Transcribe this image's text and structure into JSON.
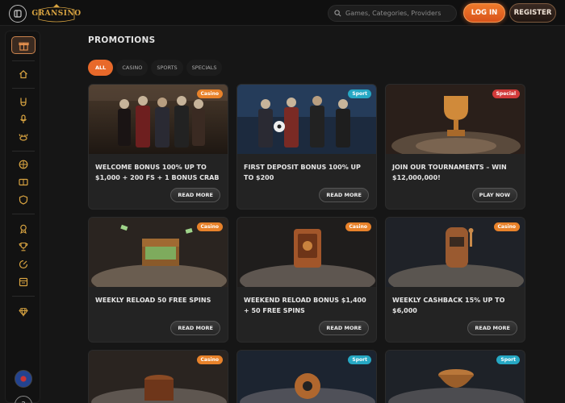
{
  "header": {
    "logo_text": "GRANSINO",
    "search_placeholder": "Games, Categories, Providers",
    "login_label": "LOG IN",
    "register_label": "REGISTER"
  },
  "page": {
    "title": "PROMOTIONS",
    "tabs": [
      {
        "label": "ALL",
        "active": true
      },
      {
        "label": "CASINO",
        "active": false
      },
      {
        "label": "SPORTS",
        "active": false
      },
      {
        "label": "SPECIALS",
        "active": false
      }
    ]
  },
  "cards": [
    {
      "badge": "Casino",
      "type": "casino",
      "text": "WELCOME BONUS 100% UP TO $1,000 + 200 FS + 1 BONUS CRAB",
      "cta": "READ MORE"
    },
    {
      "badge": "Sport",
      "type": "sport",
      "text": "FIRST DEPOSIT BONUS 100% UP TO $200",
      "cta": "READ MORE"
    },
    {
      "badge": "Special",
      "type": "special",
      "text": "JOIN OUR TOURNAMENTS – WIN $12,000,000!",
      "cta": "PLAY NOW"
    },
    {
      "badge": "Casino",
      "type": "casino",
      "text": "WEEKLY RELOAD 50 FREE SPINS",
      "cta": "READ MORE"
    },
    {
      "badge": "Casino",
      "type": "casino",
      "text": "WEEKEND RELOAD BONUS $1,400 + 50 FREE SPINS",
      "cta": "READ MORE"
    },
    {
      "badge": "Casino",
      "type": "casino",
      "text": "WEEKLY CASHBACK 15% UP TO $6,000",
      "cta": "READ MORE"
    },
    {
      "badge": "Casino",
      "type": "casino"
    },
    {
      "badge": "Sport",
      "type": "sport"
    },
    {
      "badge": "Sport",
      "type": "sport"
    }
  ],
  "colors": {
    "accent": "#e8692a",
    "casino_badge": "#e8822a",
    "sport_badge": "#26a8c4",
    "special_badge": "#d23a3a",
    "icon_gold": "#d9a441"
  }
}
